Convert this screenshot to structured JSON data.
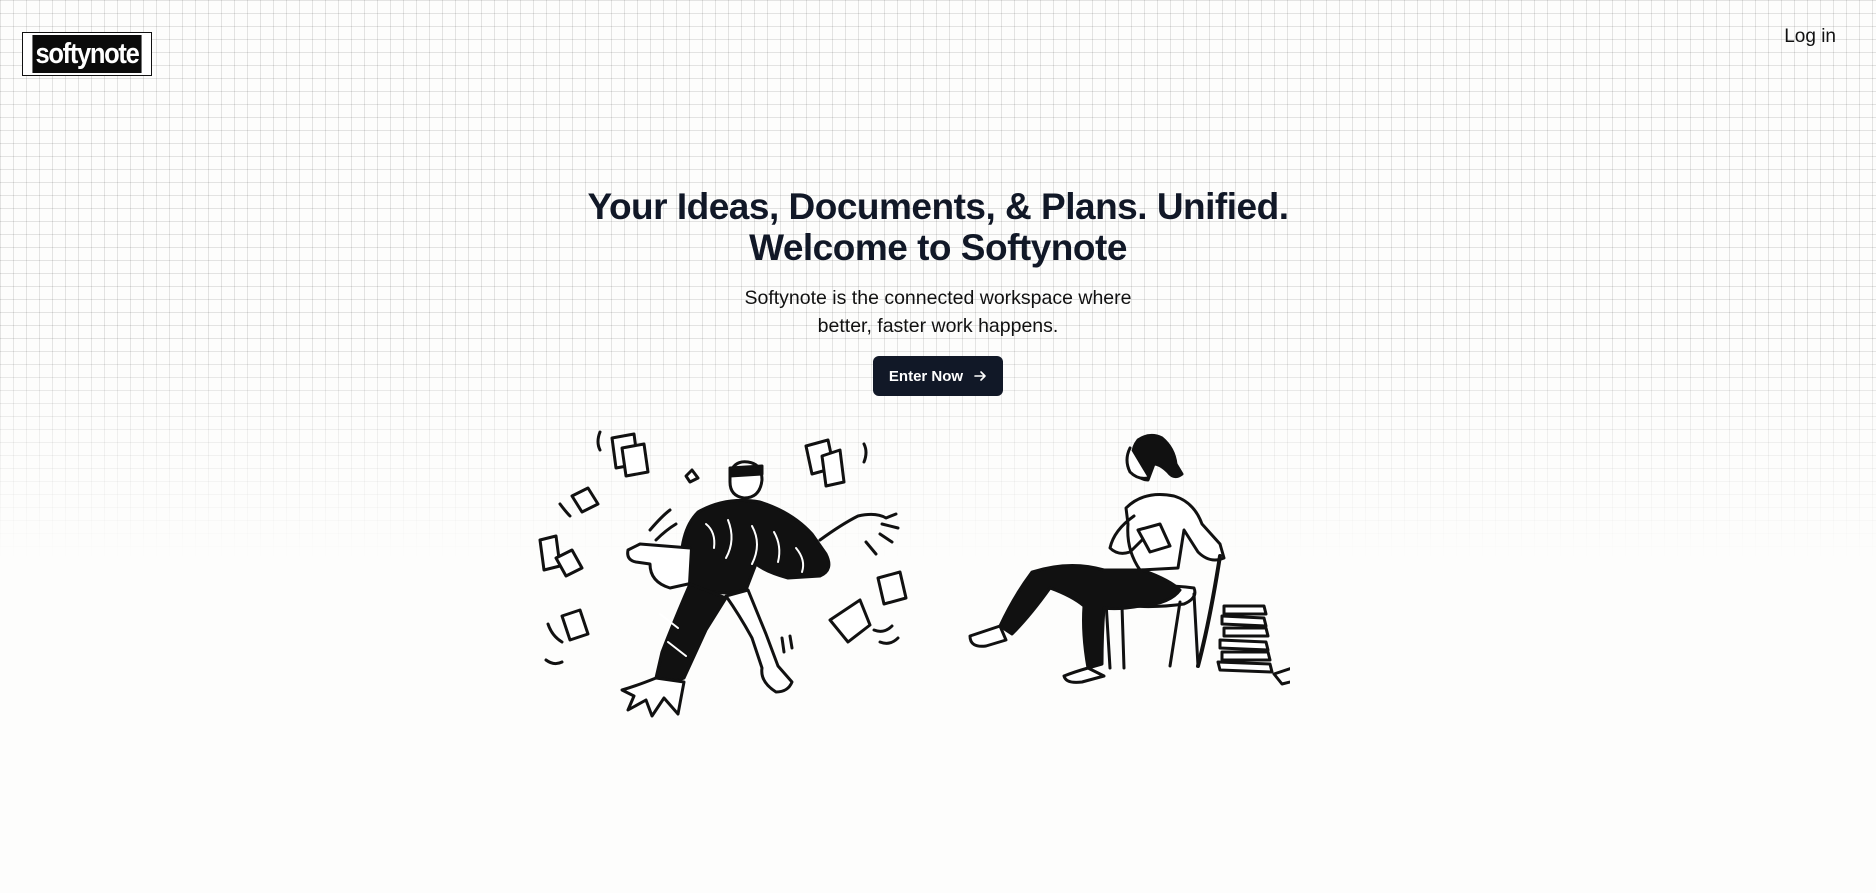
{
  "header": {
    "logo_text": "softynote",
    "login_label": "Log in"
  },
  "hero": {
    "title_line1": "Your Ideas, Documents, & Plans. Unified.",
    "title_line2": "Welcome to Softynote",
    "subtitle_line1": "Softynote is the connected workspace where",
    "subtitle_line2": "better, faster work happens.",
    "cta_label": "Enter Now",
    "cta_icon": "arrow-right-icon"
  },
  "illustration": {
    "left": "man-juggling-papers-illustration",
    "right": "woman-reading-in-chair-illustration"
  },
  "colors": {
    "background": "#fdfdfc",
    "text": "#111827",
    "button_bg": "#111827",
    "button_text": "#ffffff"
  }
}
